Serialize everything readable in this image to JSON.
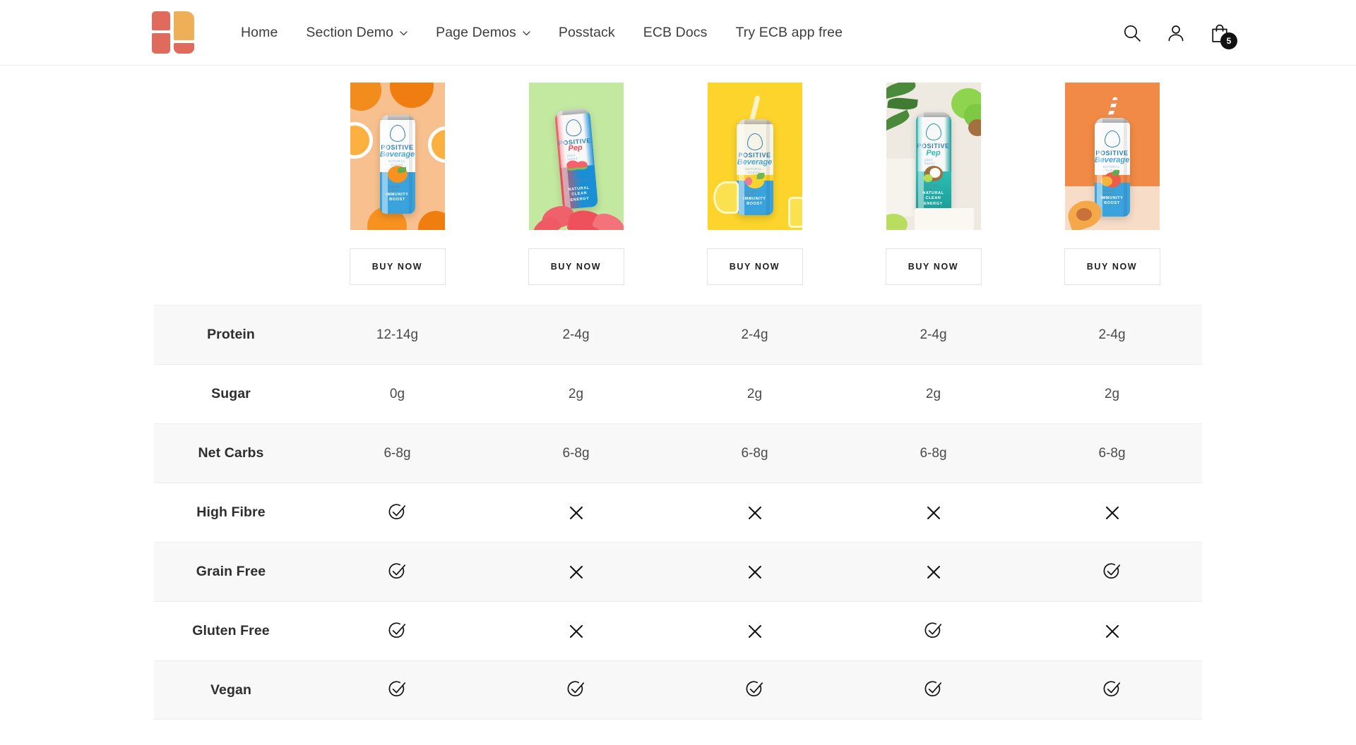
{
  "header": {
    "logo_name": "site-logo",
    "nav": [
      {
        "label": "Home",
        "has_dropdown": false
      },
      {
        "label": "Section Demo",
        "has_dropdown": true
      },
      {
        "label": "Page Demos",
        "has_dropdown": true
      },
      {
        "label": "Posstack",
        "has_dropdown": false
      },
      {
        "label": "ECB Docs",
        "has_dropdown": false
      },
      {
        "label": "Try ECB app free",
        "has_dropdown": false
      }
    ],
    "actions": {
      "search_icon": "search-icon",
      "account_icon": "user-account-icon",
      "cart_icon": "shopping-bag-icon",
      "cart_count": "5"
    }
  },
  "products": [
    {
      "name": "Positive Beverage Immunity Boost Orange",
      "flavour": "Orange",
      "buy_label": "BUY NOW",
      "bg": "#f7c08e",
      "can_lower": "#3aa3dd",
      "brand_line1": "POSITIVE",
      "brand_line2": "Beverage",
      "tagline": "IMMUNITY\nBOOST",
      "fruit": "orange",
      "straw": false
    },
    {
      "name": "Positive Pep Watermelon",
      "flavour": "Watermelon Rush",
      "buy_label": "BUY NOW",
      "bg": "#c3e8a0",
      "can_lower": "#e94b55",
      "brand_line1": "POSITIVE",
      "brand_line2": "Pep",
      "tagline": "NATURAL\nCLEAN ENERGY",
      "fruit": "watermelon",
      "straw": false
    },
    {
      "name": "Positive Beverage Immunity Boost Lemon",
      "flavour": "Lemon",
      "buy_label": "BUY NOW",
      "bg": "#fcd42b",
      "can_lower": "#3aa3dd",
      "brand_line1": "POSITIVE",
      "brand_line2": "Beverage",
      "tagline": "IMMUNITY\nBOOST",
      "fruit": "lemon",
      "straw": true
    },
    {
      "name": "Positive Pep Coconut Lime",
      "flavour": "Coconut Lime",
      "buy_label": "BUY NOW",
      "bg": "#eeeae2",
      "can_lower": "#23b2ac",
      "brand_line1": "POSITIVE",
      "brand_line2": "Pep",
      "tagline": "NATURAL\nCLEAN ENERGY",
      "fruit": "coconut",
      "straw": false
    },
    {
      "name": "Positive Beverage Immunity Boost Peach",
      "flavour": "Peach",
      "buy_label": "BUY NOW",
      "bg": "#f08a46",
      "can_lower": "#3aa3dd",
      "brand_line1": "POSITIVE",
      "brand_line2": "Beverage",
      "tagline": "IMMUNITY\nBOOST",
      "fruit": "peach",
      "straw": true
    }
  ],
  "table": {
    "rows": [
      {
        "label": "Protein",
        "type": "text",
        "values": [
          "12-14g",
          "2-4g",
          "2-4g",
          "2-4g",
          "2-4g"
        ]
      },
      {
        "label": "Sugar",
        "type": "text",
        "values": [
          "0g",
          "2g",
          "2g",
          "2g",
          "2g"
        ]
      },
      {
        "label": "Net Carbs",
        "type": "text",
        "values": [
          "6-8g",
          "6-8g",
          "6-8g",
          "6-8g",
          "6-8g"
        ]
      },
      {
        "label": "High Fibre",
        "type": "mark",
        "values": [
          "check",
          "cross",
          "cross",
          "cross",
          "cross"
        ]
      },
      {
        "label": "Grain Free",
        "type": "mark",
        "values": [
          "check",
          "cross",
          "cross",
          "cross",
          "check"
        ]
      },
      {
        "label": "Gluten Free",
        "type": "mark",
        "values": [
          "check",
          "cross",
          "cross",
          "check",
          "cross"
        ]
      },
      {
        "label": "Vegan",
        "type": "mark",
        "values": [
          "check",
          "check",
          "check",
          "check",
          "check"
        ]
      }
    ]
  },
  "colors": {
    "brand_red": "#e06a5b",
    "brand_yellow": "#eeb057",
    "row_alt_bg": "#f8f8f8",
    "row_border": "#ededed",
    "badge_bg": "#111111",
    "text_primary": "#2e2e2e"
  }
}
